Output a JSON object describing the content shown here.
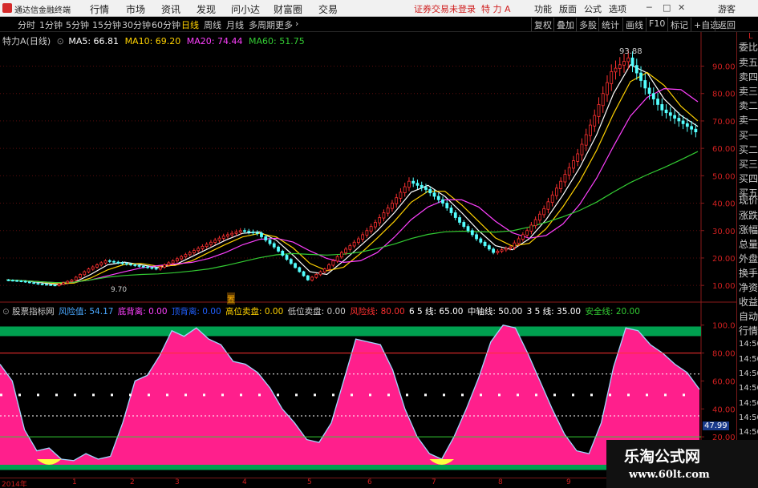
{
  "menubar": {
    "app_name": "通达信金融终端",
    "items": [
      "行情",
      "市场",
      "资讯",
      "发现",
      "问小达",
      "财富圈",
      "交易"
    ],
    "status": "证券交易未登录",
    "stock": "特 力 A",
    "right": [
      "功能",
      "版面",
      "公式",
      "选项"
    ],
    "login": "游客"
  },
  "toolbar": {
    "periods": [
      "分时",
      "1分钟",
      "5分钟",
      "15分钟",
      "30分钟",
      "60分钟",
      "日线",
      "周线",
      "月线",
      "多周期",
      "更多"
    ],
    "active_period": "日线",
    "right": [
      "复权",
      "叠加",
      "多股",
      "统计",
      "画线",
      "F10",
      "标记",
      "+自选",
      "返回"
    ]
  },
  "price_header": {
    "stock": "特力A",
    "period": "(日线)",
    "ma5": "MA5: 66.81",
    "ma10": "MA10: 69.20",
    "ma20": "MA20: 74.44",
    "ma60": "MA60: 51.75",
    "high_label": "93.88",
    "low_label": "9.70",
    "marker": "置"
  },
  "price_axis": [
    "90.00",
    "80.00",
    "70.00",
    "60.00",
    "50.00",
    "40.00",
    "30.00",
    "20.00",
    "10.00"
  ],
  "indicator_header": {
    "name": "股票指标网",
    "risk": "风险值: 54.17",
    "bottom_div": "底背离: 0.00",
    "top_div": "顶背离: 0.00",
    "high_sell": "高位卖盘: 0.00",
    "low_sell": "低位卖盘: 0.00",
    "risk_line": "风险线: 80.00",
    "line65": "6 5 线: 65.00",
    "mid_line": "中轴线: 50.00",
    "line35": "3 5 线: 35.00",
    "safe_line": "安全线: 20.00"
  },
  "indicator_axis": [
    "100.0",
    "80.00",
    "60.00",
    "40.00",
    "20.00"
  ],
  "indicator_current": "47.99",
  "sidebar": [
    "L",
    "委比",
    "卖五",
    "卖四",
    "卖三",
    "卖二",
    "卖一",
    "买一",
    "买二",
    "买三",
    "买四",
    "买五",
    "现价",
    "涨跌",
    "涨幅",
    "总量",
    "外盘",
    "换手",
    "净资",
    "收益",
    "自动",
    "行情",
    "14:50",
    "14:50",
    "14:50",
    "14:50",
    "14:50",
    "14:50",
    "14:50",
    "14:50"
  ],
  "time_axis": [
    "2014年",
    "1",
    "2",
    "3",
    "4",
    "5",
    "6",
    "7",
    "8",
    "9"
  ],
  "watermark": {
    "line1": "乐淘公式网",
    "line2": "www.60lt.com"
  },
  "colors": {
    "pink_fill": "#ff1f8c",
    "green_band": "#00a050",
    "axis_red": "#d02020",
    "ma5": "#ffffff",
    "ma10": "#ffd200",
    "ma20": "#ff40ff",
    "ma60": "#33cc33"
  },
  "chart_data": [
    {
      "type": "candlestick",
      "title": "特力A (日线)",
      "ylim": [
        5,
        100
      ],
      "x": [
        "2014",
        "1",
        "2",
        "3",
        "4",
        "5",
        "6",
        "7",
        "8",
        "9"
      ],
      "close": [
        12,
        11.5,
        10.5,
        10,
        12,
        16,
        19,
        18,
        17,
        16,
        19,
        22,
        25,
        28,
        30,
        29,
        24,
        18,
        12,
        16,
        22,
        27,
        33,
        40,
        48,
        45,
        40,
        33,
        27,
        22,
        24,
        30,
        38,
        48,
        58,
        72,
        88,
        93,
        82,
        74,
        70,
        66
      ],
      "series": [
        {
          "name": "MA5",
          "value": 66.81
        },
        {
          "name": "MA10",
          "value": 69.2
        },
        {
          "name": "MA20",
          "value": 74.44
        },
        {
          "name": "MA60",
          "value": 51.75
        }
      ]
    },
    {
      "type": "area",
      "title": "股票指标网",
      "ylim": [
        0,
        105
      ],
      "values": [
        72,
        60,
        25,
        10,
        12,
        4,
        3,
        8,
        4,
        6,
        30,
        60,
        64,
        78,
        96,
        92,
        98,
        90,
        86,
        74,
        72,
        66,
        55,
        40,
        30,
        18,
        16,
        30,
        60,
        90,
        88,
        86,
        68,
        40,
        20,
        8,
        4,
        20,
        40,
        62,
        88,
        100,
        98,
        80,
        60,
        40,
        22,
        10,
        8,
        30,
        70,
        98,
        96,
        86,
        80,
        72,
        66,
        54
      ],
      "reference_lines": [
        {
          "name": "风险线",
          "value": 80
        },
        {
          "name": "6 5 线",
          "value": 65
        },
        {
          "name": "中轴线",
          "value": 50
        },
        {
          "name": "3 5 线",
          "value": 35
        },
        {
          "name": "安全线",
          "value": 20
        }
      ]
    }
  ]
}
